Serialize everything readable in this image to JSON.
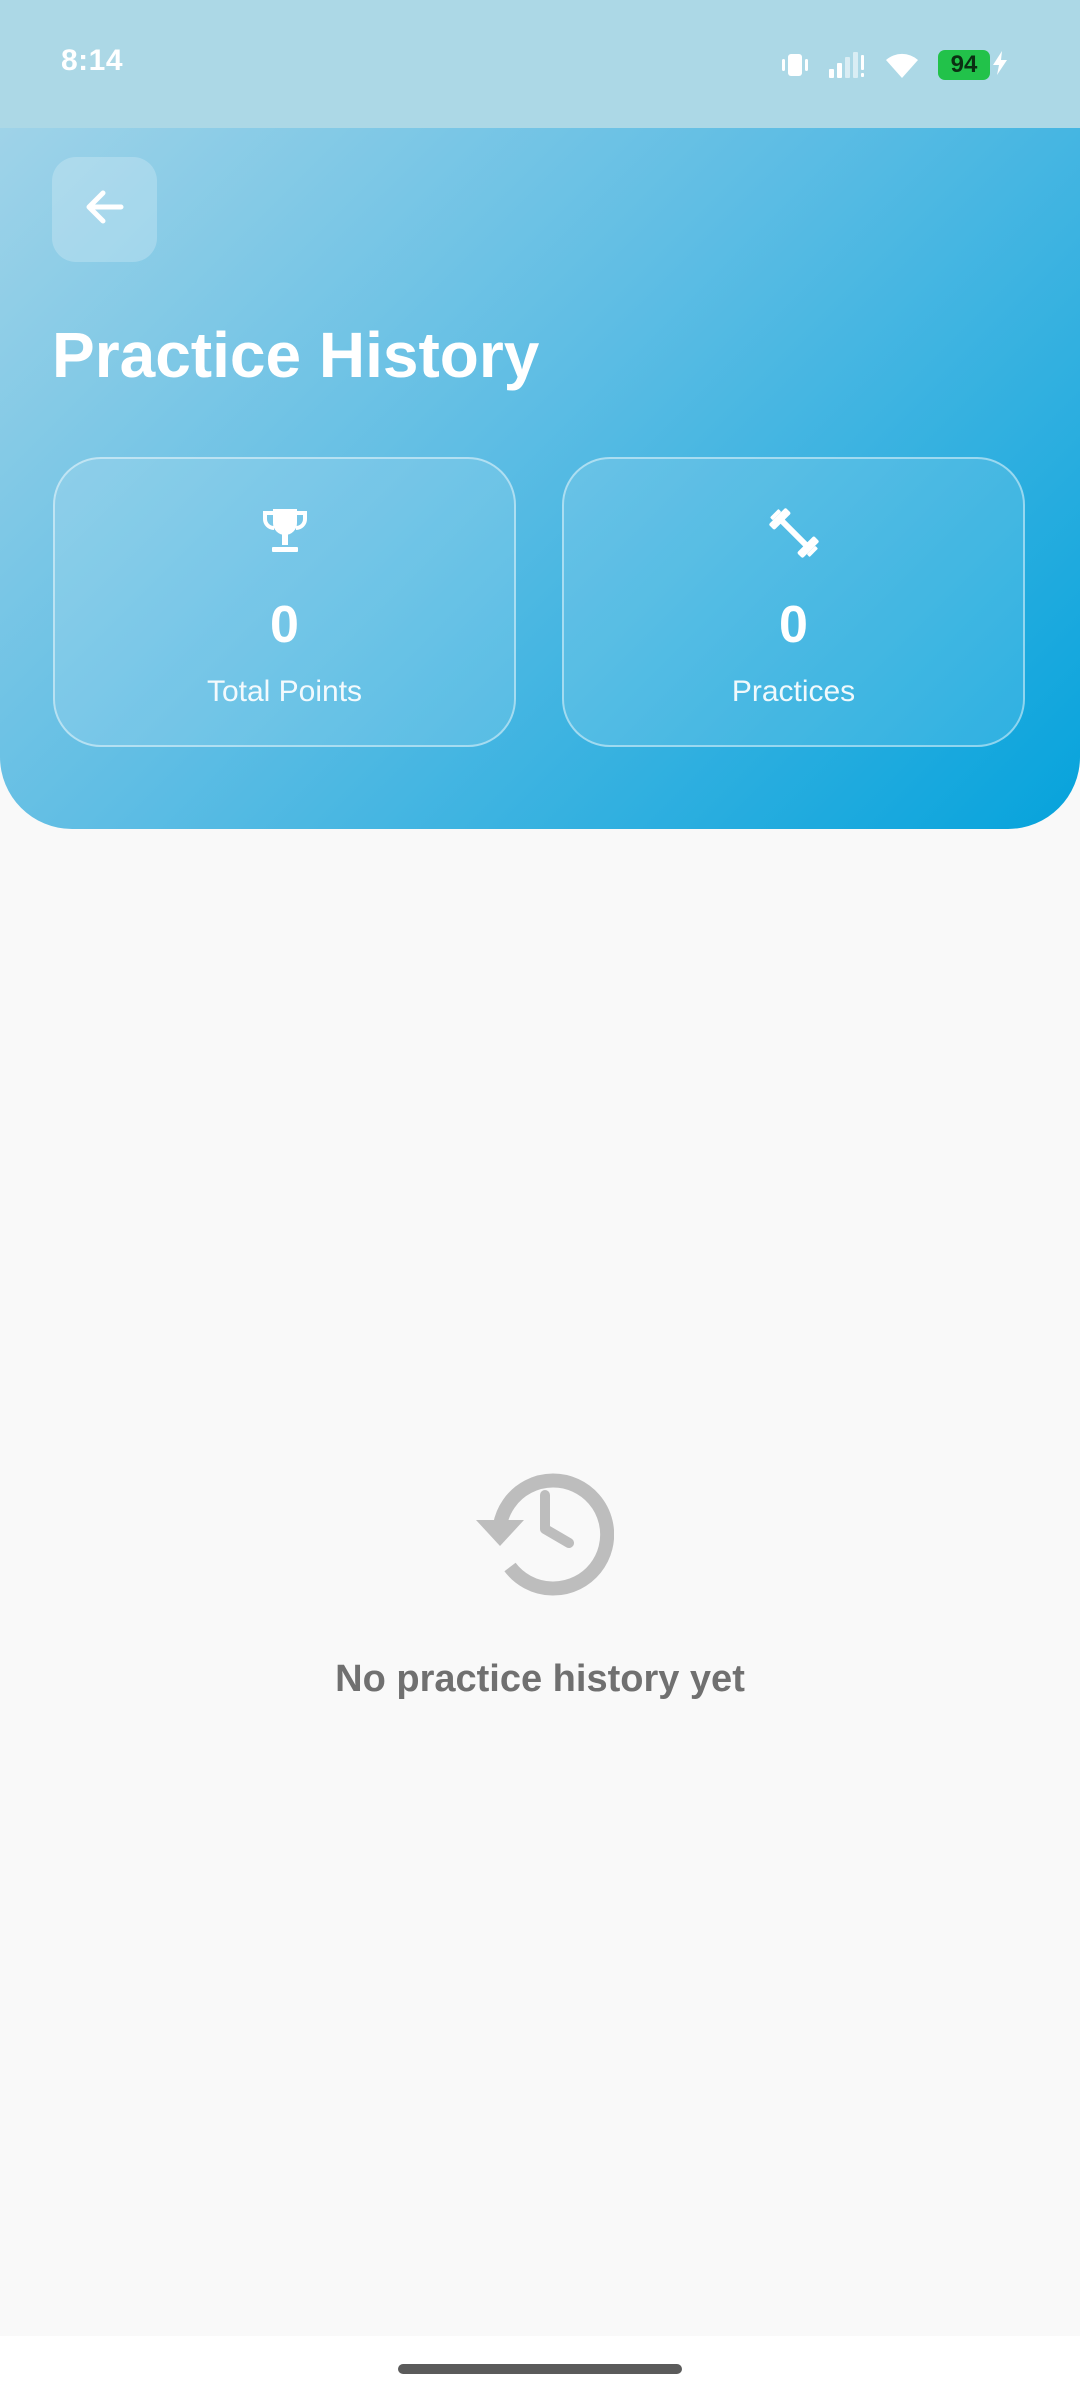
{
  "status_bar": {
    "time": "8:14",
    "battery_level": "94",
    "icons": [
      "vibrate-icon",
      "signal-icon",
      "wifi-icon",
      "battery-icon",
      "charging-icon"
    ]
  },
  "header": {
    "back_icon": "arrow-left-icon",
    "title": "Practice History",
    "stats": [
      {
        "icon": "trophy-icon",
        "value": "0",
        "label": "Total Points"
      },
      {
        "icon": "dumbbell-icon",
        "value": "0",
        "label": "Practices"
      }
    ]
  },
  "empty_state": {
    "icon": "history-icon",
    "message": "No practice history yet"
  },
  "colors": {
    "status_bar_bg": "#acd8e6",
    "header_gradient_start": "#9fd3e8",
    "header_gradient_end": "#06a3dc",
    "page_bg": "#f9f9f9",
    "empty_text": "#707070",
    "battery_green": "#22c24a"
  }
}
